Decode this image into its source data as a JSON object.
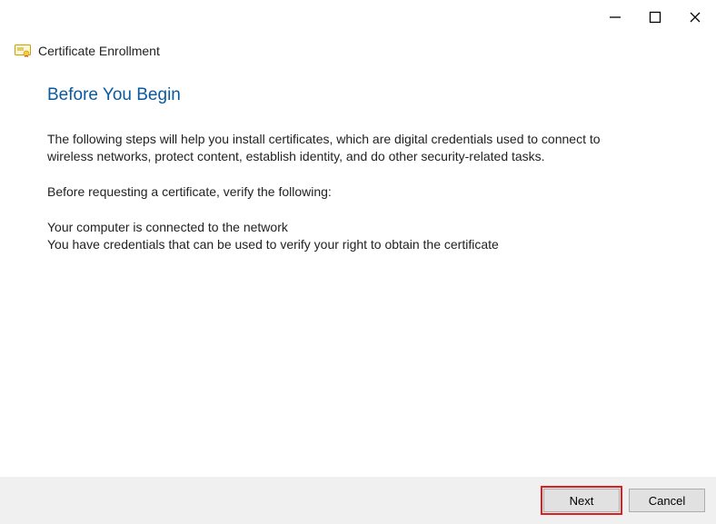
{
  "titlebar": {
    "minimize_label": "Minimize",
    "maximize_label": "Maximize",
    "close_label": "Close"
  },
  "header": {
    "title": "Certificate Enrollment",
    "icon": "certificate-icon"
  },
  "page": {
    "heading": "Before You Begin",
    "intro": "The following steps will help you install certificates, which are digital credentials used to connect to wireless networks, protect content, establish identity, and do other security-related tasks.",
    "verify_prompt": "Before requesting a certificate, verify the following:",
    "checks": [
      "Your computer is connected to the network",
      "You have credentials that can be used to verify your right to obtain the certificate"
    ]
  },
  "footer": {
    "next_label": "Next",
    "cancel_label": "Cancel"
  }
}
